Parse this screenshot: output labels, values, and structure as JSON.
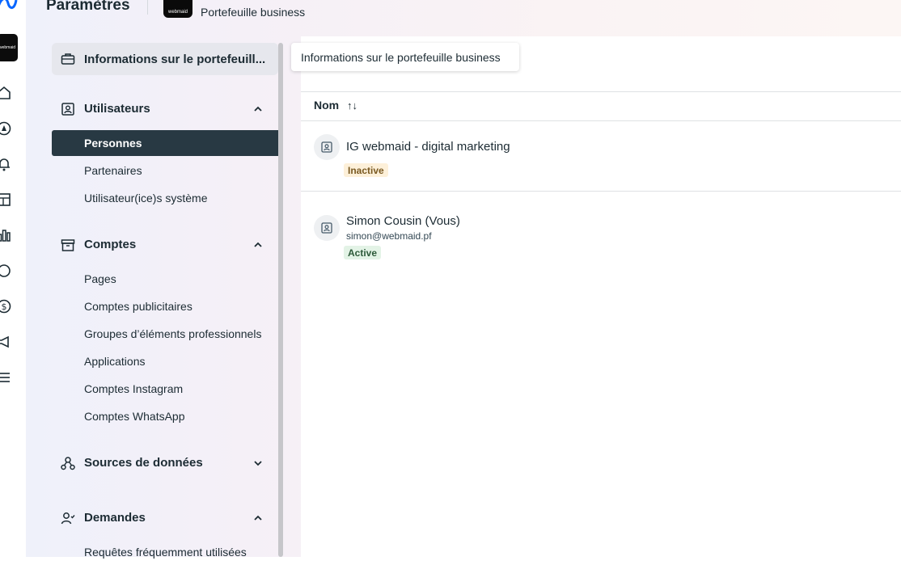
{
  "header": {
    "page_title": "Paramètres",
    "business_name": "Portefeuille business",
    "avatar_text": "webmaid"
  },
  "rail": {
    "icons": [
      "meta-logo-icon",
      "avatar",
      "home-icon",
      "compass-icon",
      "bell-icon",
      "pages-icon",
      "bar-chart-icon",
      "circle-icon",
      "dollar-icon",
      "megaphone-icon",
      "menu-icon"
    ]
  },
  "sidebar": {
    "top_item": "Informations sur le portefeuill...",
    "sections": [
      {
        "label": "Utilisateurs",
        "expanded": true,
        "items": [
          "Personnes",
          "Partenaires",
          "Utilisateur(ice)s système"
        ],
        "active_item": "Personnes"
      },
      {
        "label": "Comptes",
        "expanded": true,
        "items": [
          "Pages",
          "Comptes publicitaires",
          "Groupes d’éléments professionnels",
          "Applications",
          "Comptes Instagram",
          "Comptes WhatsApp"
        ]
      },
      {
        "label": "Sources de données",
        "expanded": false,
        "items": []
      },
      {
        "label": "Demandes",
        "expanded": true,
        "items": [
          "Requêtes fréquemment utilisées"
        ]
      }
    ]
  },
  "tooltip": "Informations sur le portefeuille business",
  "table": {
    "column_header": "Nom",
    "sort_glyph": "↑↓",
    "rows": [
      {
        "name": "IG webmaid - digital marketing",
        "email": "",
        "status": "Inactive"
      },
      {
        "name": "Simon Cousin (Vous)",
        "email": "simon@webmaid.pf",
        "status": "Active"
      }
    ]
  },
  "colors": {
    "active_nav_bg": "#283943",
    "inactive_badge_bg": "#fdf0d9",
    "active_badge_bg": "#e3f3e6"
  }
}
